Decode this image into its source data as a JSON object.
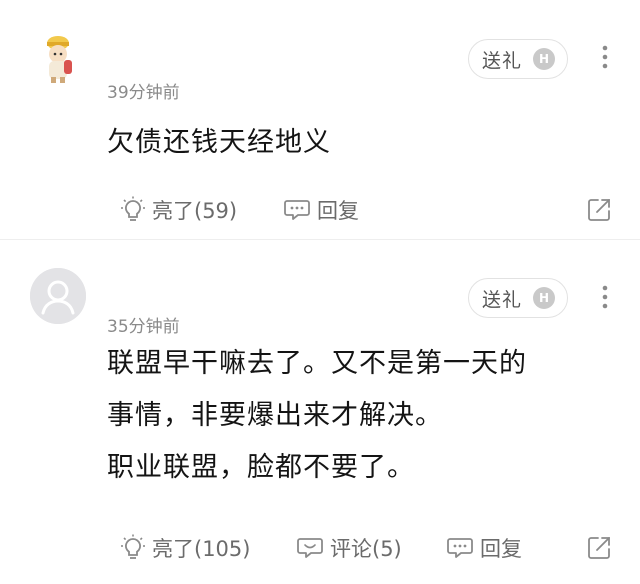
{
  "comments": [
    {
      "time": "39分钟前",
      "gift_label": "送礼",
      "gift_badge": "H",
      "lines": [
        "欠债还钱天经地义"
      ],
      "like_label": "亮了(59)",
      "reply_label": "回复"
    },
    {
      "time": "35分钟前",
      "gift_label": "送礼",
      "gift_badge": "H",
      "lines": [
        "联盟早干嘛去了。又不是第一天的",
        "事情，非要爆出来才解决。",
        "职业联盟，脸都不要了。"
      ],
      "like_label": "亮了(105)",
      "comment_label": "评论(5)",
      "reply_label": "回复"
    }
  ]
}
